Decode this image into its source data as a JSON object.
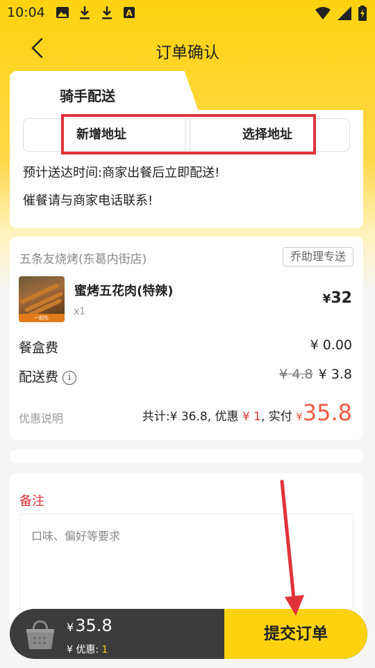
{
  "status_bar": {
    "time": "10:04"
  },
  "nav": {
    "title": "订单确认"
  },
  "delivery": {
    "tab_label": "骑手配送",
    "add_address": "新增地址",
    "select_address": "选择地址",
    "eta_text": "预计送达时间:商家出餐后立即配送!",
    "contact_text": "催餐请与商家电话联系!"
  },
  "order": {
    "store_name": "五条友烧烤(东葛内街店)",
    "delivery_badge": "乔助理专送",
    "thumb_tag": "一起吃",
    "item": {
      "name": "蜜烤五花肉(特辣)",
      "qty": "x1",
      "price_symbol": "¥",
      "price": "32"
    },
    "box_fee": {
      "label": "餐盒费",
      "value": "¥ 0.00"
    },
    "delivery_fee": {
      "label": "配送费",
      "original": "¥ 4.8",
      "value": "¥ 3.8"
    },
    "discount_desc": "优惠说明",
    "summary": {
      "total_prefix": "共计:",
      "total": "¥ 36.8",
      "discount_prefix": ", 优惠",
      "discount": "¥ 1",
      "paid_prefix": ", 实付",
      "paid_symbol": "¥",
      "paid": "35.8"
    }
  },
  "remark": {
    "title": "备注",
    "placeholder": "口味、偏好等要求"
  },
  "bottom_bar": {
    "total_symbol": "¥",
    "total": "35.8",
    "discount_label": "¥ 优惠:",
    "discount_value": "1",
    "submit_label": "提交订单"
  },
  "colors": {
    "brand_yellow": "#ffd30f",
    "price_red": "#f25a40",
    "annotation_red": "#e0323a"
  }
}
